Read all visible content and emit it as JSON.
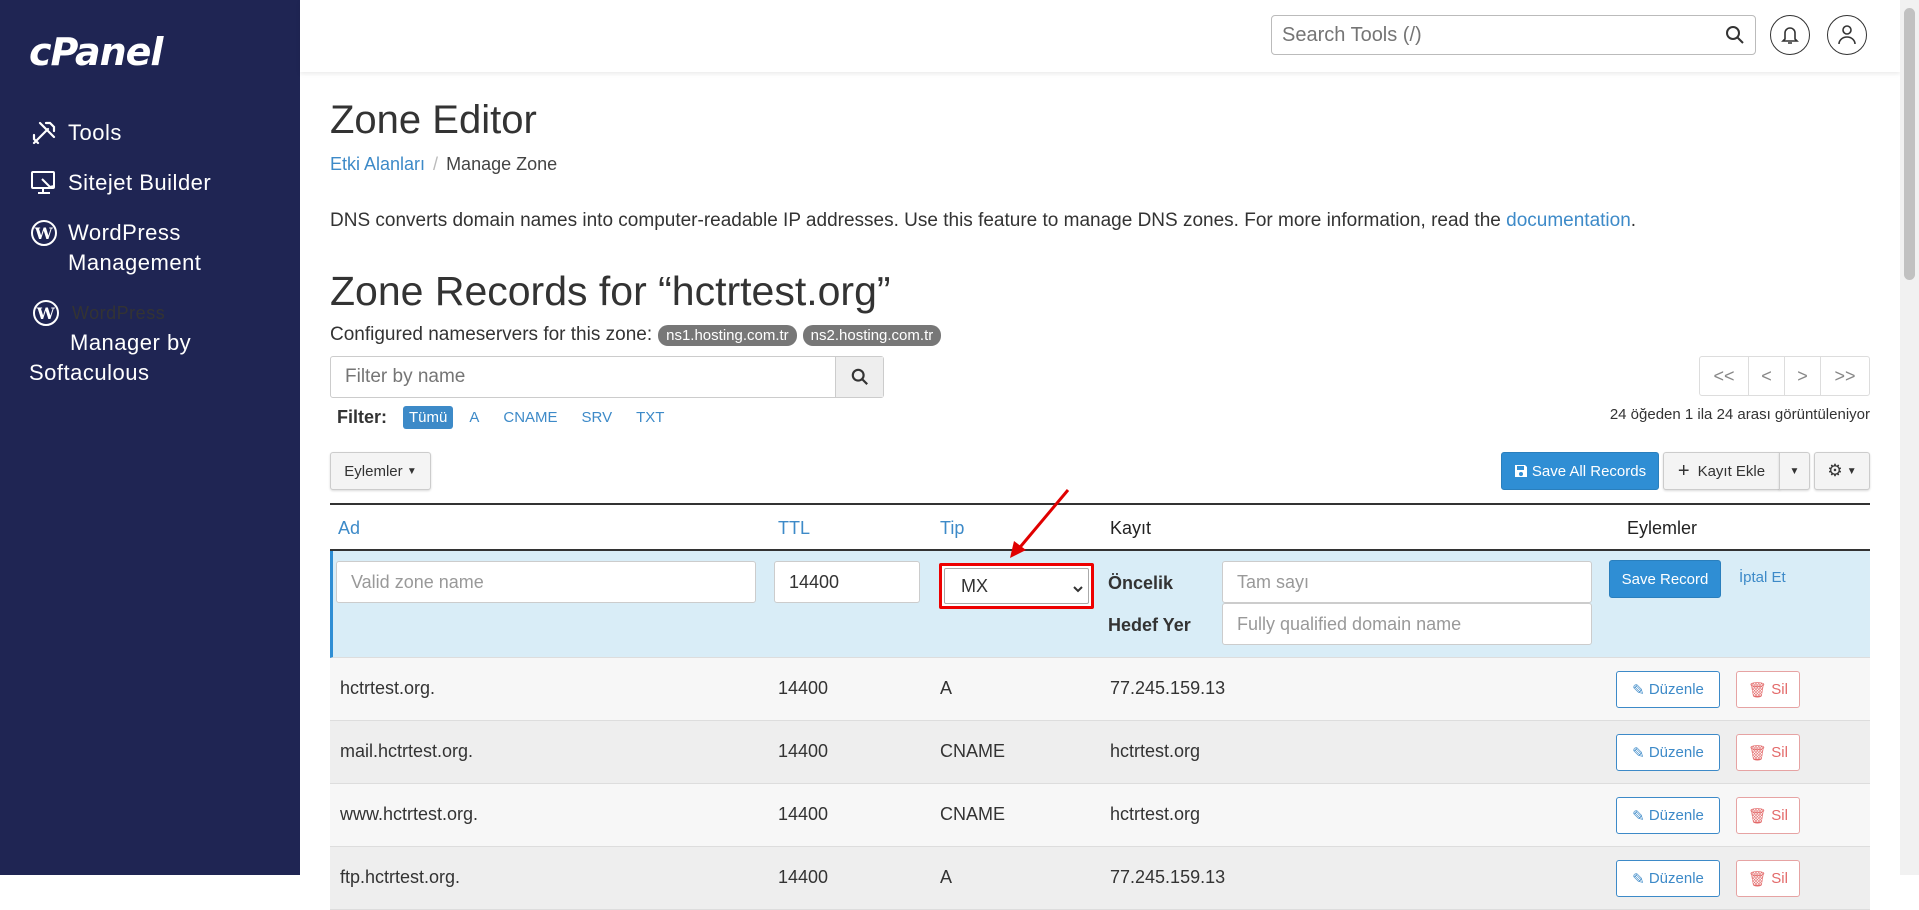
{
  "sidebar": {
    "logo": "cPanel",
    "items": [
      {
        "label": "Tools",
        "icon": "tools-icon"
      },
      {
        "label": "Sitejet Builder",
        "icon": "monitor-brush-icon"
      },
      {
        "label": "WordPress Management",
        "icon": "wordpress-icon"
      },
      {
        "label_line1": "WordPress",
        "label_line2": "Manager by",
        "label_line3": "Softaculous",
        "icon": "wordpress-icon"
      }
    ]
  },
  "header": {
    "search_placeholder": "Search Tools (/)"
  },
  "page": {
    "title": "Zone Editor",
    "breadcrumb": {
      "parent": "Etki Alanları",
      "current": "Manage Zone"
    },
    "description": "DNS converts domain names into computer-readable IP addresses. Use this feature to manage DNS zones. For more information, read the",
    "description_link": "documentation",
    "zone_title": "Zone Records for “hctrtest.org”",
    "ns_label": "Configured nameservers for this zone:",
    "nameservers": [
      "ns1.hosting.com.tr",
      "ns2.hosting.com.tr"
    ],
    "filter_placeholder": "Filter by name",
    "pager": [
      "<<",
      "<",
      ">",
      ">>"
    ],
    "range_text": "24 öğeden 1 ila 24 arası görüntüleniyor",
    "filter_label": "Filter:",
    "filter_types": [
      "Tümü",
      "A",
      "CNAME",
      "SRV",
      "TXT"
    ],
    "actions_button": "Eylemler",
    "save_all": "Save All Records",
    "add_record": "Kayıt Ekle"
  },
  "table": {
    "headers": {
      "name": "Ad",
      "ttl": "TTL",
      "type": "Tip",
      "record": "Kayıt",
      "actions": "Eylemler"
    },
    "edit_row": {
      "name_placeholder": "Valid zone name",
      "ttl_value": "14400",
      "type_value": "MX",
      "priority_label": "Öncelik",
      "priority_placeholder": "Tam sayı",
      "dest_label": "Hedef Yer",
      "dest_placeholder": "Fully qualified domain name",
      "save_label": "Save Record",
      "cancel_label": "İptal Et"
    },
    "edit_label": "Düzenle",
    "delete_label": "Sil",
    "rows": [
      {
        "name": "hctrtest.org.",
        "ttl": "14400",
        "type": "A",
        "record": "77.245.159.13"
      },
      {
        "name": "mail.hctrtest.org.",
        "ttl": "14400",
        "type": "CNAME",
        "record": "hctrtest.org"
      },
      {
        "name": "www.hctrtest.org.",
        "ttl": "14400",
        "type": "CNAME",
        "record": "hctrtest.org"
      },
      {
        "name": "ftp.hctrtest.org.",
        "ttl": "14400",
        "type": "A",
        "record": "77.245.159.13"
      }
    ]
  },
  "colors": {
    "sidebar_bg": "#1f2553",
    "primary": "#2f8ed4",
    "link": "#3d8ac8",
    "annotation": "#e00000",
    "edit_row_bg": "#d9edf7"
  }
}
